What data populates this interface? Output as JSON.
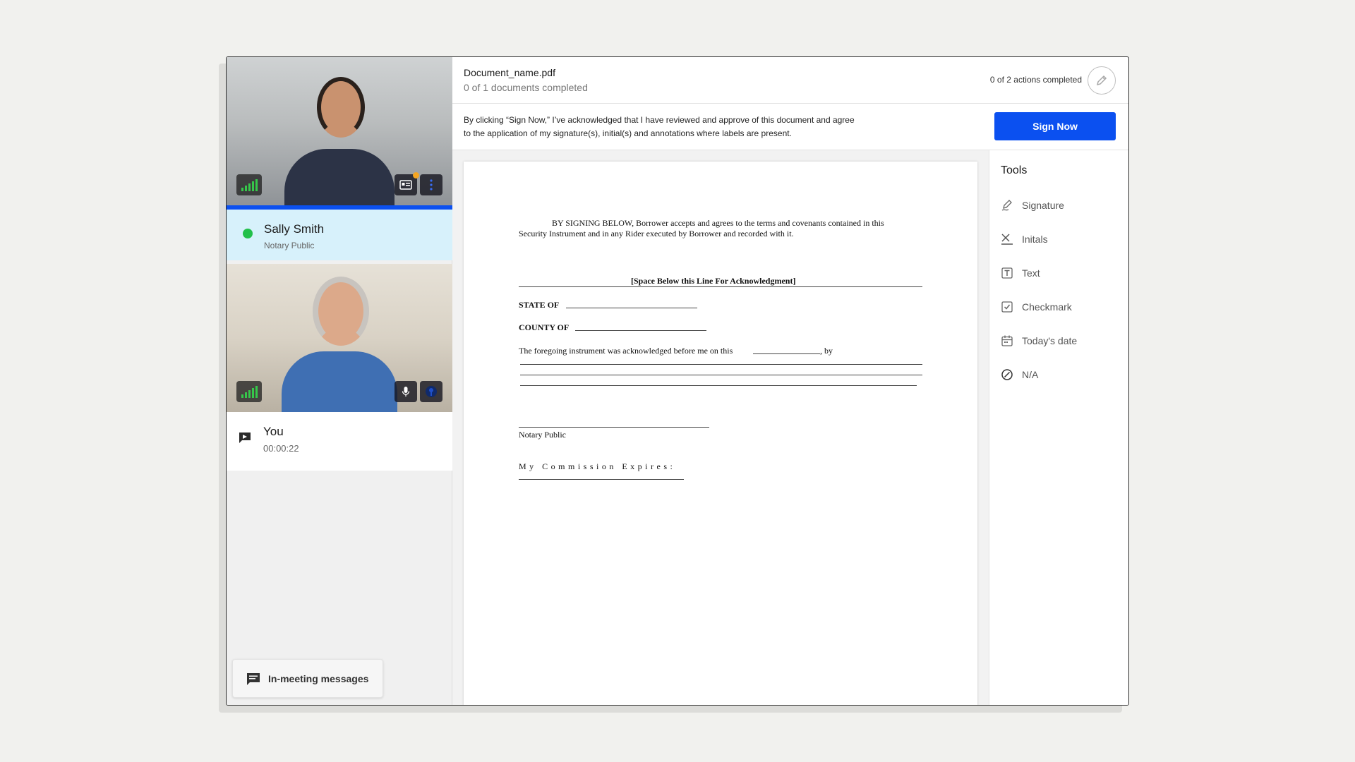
{
  "document": {
    "name": "Document_name.pdf",
    "progress": "0 of 1 documents completed",
    "actions": "0 of 2 actions completed"
  },
  "consent": {
    "line1": "By clicking “Sign Now,” I’ve acknowledged that I have reviewed and approve of this document and agree",
    "line2": "to the application of my signature(s), initial(s) and annotations where labels are present.",
    "button": "Sign Now"
  },
  "participants": [
    {
      "name": "Sally Smith",
      "role": "Notary Public"
    },
    {
      "name": "You",
      "time": "00:00:22"
    }
  ],
  "messages_button": "In-meeting messages",
  "tools": {
    "title": "Tools",
    "items": [
      {
        "label": "Signature",
        "icon": "signature-icon"
      },
      {
        "label": "Initals",
        "icon": "initials-icon"
      },
      {
        "label": "Text",
        "icon": "text-icon"
      },
      {
        "label": "Checkmark",
        "icon": "checkmark-icon"
      },
      {
        "label": "Today's date",
        "icon": "calendar-icon"
      },
      {
        "label": "N/A",
        "icon": "na-icon"
      }
    ]
  },
  "page": {
    "para1": "BY SIGNING BELOW, Borrower accepts and agrees to the terms and covenants contained in this",
    "para2": "Security Instrument and in any Rider executed by Borrower and recorded with it.",
    "ack": "[Space Below this Line For Acknowledgment]",
    "state": "STATE OF",
    "county": "COUNTY OF",
    "foregoing": "The foregoing instrument was acknowledged before me on this",
    "by": ", by",
    "notary": "Notary Public",
    "commission": "My Commission Expires:"
  },
  "colors": {
    "accent": "#0b50f0",
    "online": "#22c04a",
    "active_bg": "#d7f1fb"
  }
}
